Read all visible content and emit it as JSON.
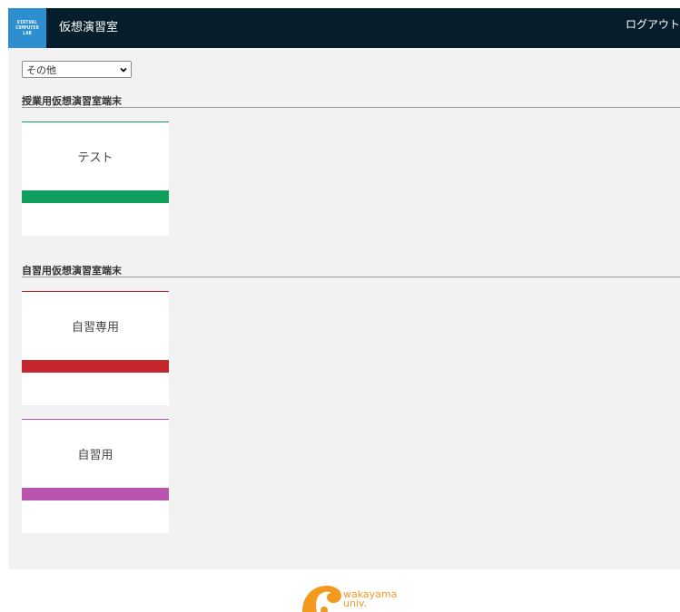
{
  "header": {
    "logo_lines": [
      "VIRTUAL",
      "COMPUTER",
      "LAB"
    ],
    "title": "仮想演習室",
    "logout_label": "ログアウト"
  },
  "filter": {
    "selected": "その他"
  },
  "sections": [
    {
      "title": "授業用仮想演習室端末",
      "cards": [
        {
          "name": "テスト",
          "color": "#109e5d"
        }
      ]
    },
    {
      "title": "自習用仮想演習室端末",
      "cards": [
        {
          "name": "自習専用",
          "color": "#c4262d"
        },
        {
          "name": "自習用",
          "color": "#b955ad"
        }
      ]
    }
  ],
  "footer": {
    "logo_text_1": "wakayama",
    "logo_text_2": "univ.",
    "logo_color": "#f39a1e"
  }
}
